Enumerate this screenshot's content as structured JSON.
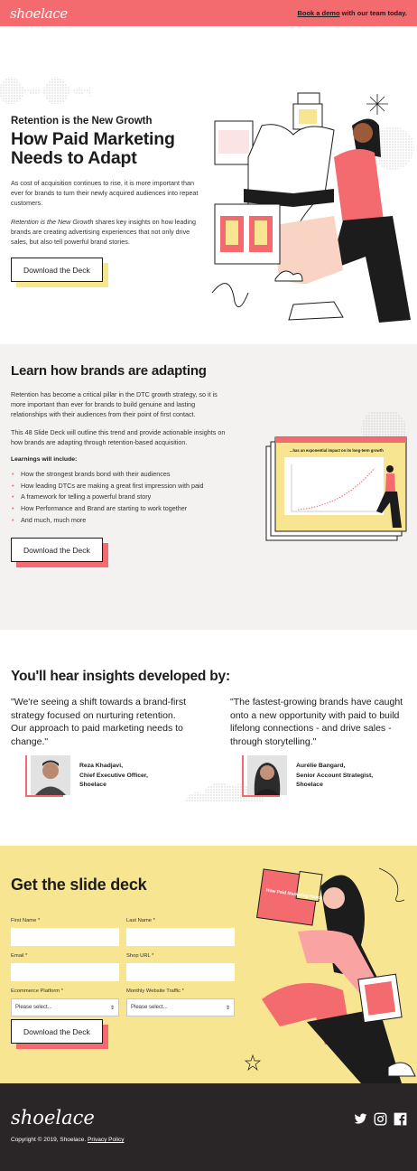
{
  "topbar": {
    "logo": "shoelace",
    "cta_link": "Book a demo",
    "cta_rest": " with our team today."
  },
  "hero": {
    "eyebrow": "Retention is the New Growth",
    "title": "How Paid Marketing Needs to Adapt",
    "p1": "As cost of acquisition continues to rise, it is more important than ever for brands to turn their newly acquired audiences into repeat customers.",
    "p2_em": "Retention is the New Growth",
    "p2_rest": " shares key insights on how leading brands are creating advertising experiences that not only drive sales, but also tell powerful brand stories.",
    "button": "Download the Deck"
  },
  "learn": {
    "title": "Learn how brands are adapting",
    "p1": "Retention has become a critical pillar in the DTC growth strategy, so it is more important than ever for brands to build genuine and lasting relationships with their audiences from their point of first contact.",
    "p2": "This 48 Slide Deck will outline this trend and provide actionable insights on how brands are adapting through retention-based acquisition.",
    "list_label": "Learnings will include:",
    "items": [
      "How the strongest brands bond with their audiences",
      "How leading DTCs are making a great first impression with paid",
      "A framework for telling a powerful brand story",
      "How Performance and Brand are starting to work together",
      "And much, much more"
    ],
    "slide_title": "...has an exponential impact on its long-term growth",
    "button": "Download the Deck"
  },
  "insights": {
    "title": "You'll hear insights developed by:",
    "quote1": "\"We're seeing a shift towards a brand-first strategy focused on nurturing retention. Our approach to paid marketing needs to change.\"",
    "quote2": "\"The fastest-growing brands have caught onto a new opportunity with paid to build lifelong connections - and drive sales - through storytelling.\"",
    "person1": {
      "name": "Reza Khadjavi,",
      "role": "Chief Executive Officer,",
      "company": "Shoelace"
    },
    "person2": {
      "name": "Aurélie Bangard,",
      "role": "Senior Account Strategist,",
      "company": "Shoelace"
    }
  },
  "form": {
    "title": "Get the slide deck",
    "first_name": "First Name *",
    "last_name": "Last Name *",
    "email": "Email *",
    "shop_url": "Shop URL *",
    "platform": "Ecommerce Platform *",
    "traffic": "Monthly Website Traffic *",
    "select_placeholder": "Please select...",
    "button": "Download the Deck",
    "slide_text": "How Paid Marketing Needs To Adapt"
  },
  "footer": {
    "logo": "shoelace",
    "copyright": "Copyright © 2019, Shoelace. ",
    "privacy": "Privacy Policy",
    "social": [
      "twitter-icon",
      "instagram-icon",
      "facebook-icon"
    ]
  },
  "colors": {
    "coral": "#f36b6f",
    "yellow": "#f8e592",
    "grey_bg": "#f4f1f1",
    "dark": "#2a2627"
  }
}
